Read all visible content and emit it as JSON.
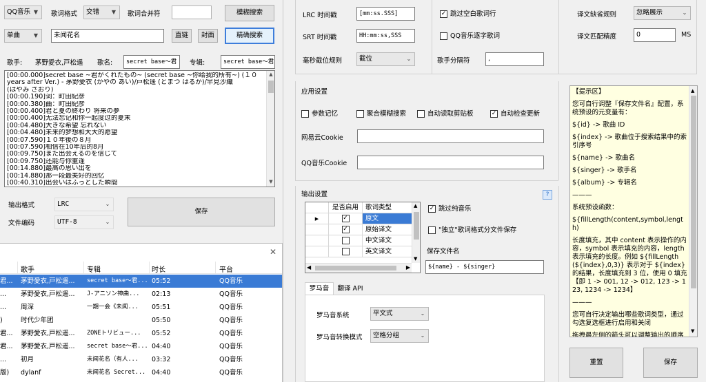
{
  "search": {
    "source_value": "QQ音乐",
    "lyric_format_label": "歌词格式",
    "lyric_format_value": "交错",
    "lyric_merge_label": "歌词合并符",
    "lyric_merge_value": "",
    "fuzzy_search_label": "模糊搜索",
    "type_value": "单曲",
    "keyword_value": "未闻花名",
    "direct_link_label": "直链",
    "cover_label": "封面",
    "exact_search_label": "精确搜索"
  },
  "song_info": {
    "singer_label": "歌手:",
    "singer_value": "茅野愛衣,戸松遥",
    "song_name_label": "歌名:",
    "song_name_value": "secret base～君",
    "album_label": "专辑:",
    "album_value": "secret base～君"
  },
  "lyrics": [
    "[00:00.000]secret base ~君がくれたもの~ (secret base ~你给我的所有~) (１０",
    "years after Ver.) - 茅野愛衣 (かやの あい)/戸松遥 (とまつ はるか)/早見沙織",
    "(はやみ さおり)",
    "[00:00.190]词：町田紀彦",
    "[00:00.380]曲：町田紀彦",
    "[00:00.400]君と夏の終わり 将来の夢",
    "[00:00.400]无法忘记和你一起度过的夏末",
    "[00:04.480]大きな希望 忘れない",
    "[00:04.480]未来的梦想和大大的愿望",
    "[00:07.590]１０年後の８月",
    "[00:07.590]相信在10年后的8月",
    "[00:09.750]また出会えるのを信じて",
    "[00:09.750]还能与你重逢",
    "[00:14.880]最高の思い出を",
    "[00:14.880]那一段最美好的回忆",
    "[00:40.310]出会いはふっとした瞬間",
    "[00:40.310]遇见你是在不经意的瞬间"
  ],
  "output": {
    "format_label": "输出格式",
    "format_value": "LRC",
    "encoding_label": "文件编码",
    "encoding_value": "UTF-8",
    "save_label": "保存"
  },
  "results": {
    "close_glyph": "✕",
    "columns": [
      "歌手",
      "专辑",
      "时长",
      "平台"
    ],
    "rows": [
      {
        "prefix": "君...",
        "singer": "茅野愛衣,戸松遥...",
        "album": "secret base～君...",
        "duration": "05:52",
        "platform": "QQ音乐",
        "selected": true
      },
      {
        "prefix": "...",
        "singer": "茅野愛衣,戸松遥...",
        "album": "J-アニソン神曲...",
        "duration": "02:13",
        "platform": "QQ音乐",
        "selected": false
      },
      {
        "prefix": "...",
        "singer": "周深",
        "album": "一期一会《未闻...",
        "duration": "05:51",
        "platform": "QQ音乐",
        "selected": false
      },
      {
        "prefix": ")",
        "singer": "时代少年团",
        "album": "",
        "duration": "05:50",
        "platform": "QQ音乐",
        "selected": false
      },
      {
        "prefix": "君...",
        "singer": "茅野愛衣,戸松遥...",
        "album": "ZONEトリビュー...",
        "duration": "05:52",
        "platform": "QQ音乐",
        "selected": false
      },
      {
        "prefix": "君...",
        "singer": "茅野愛衣,戸松遥...",
        "album": "secret base～君...",
        "duration": "04:40",
        "platform": "QQ音乐",
        "selected": false
      },
      {
        "prefix": "...",
        "singer": "初月",
        "album": "未闻花名（有人...",
        "duration": "03:32",
        "platform": "QQ音乐",
        "selected": false
      },
      {
        "prefix": "版)",
        "singer": "dylanf",
        "album": "未闻花名 Secret...",
        "duration": "04:40",
        "platform": "QQ音乐",
        "selected": false
      }
    ]
  },
  "timestamps": {
    "lrc_label": "LRC 时间戳",
    "lrc_value": "[mm:ss.SSS]",
    "srt_label": "SRT 时间戳",
    "srt_value": "HH:mm:ss,SSS",
    "ms_rule_label": "毫秒截位规则",
    "ms_rule_value": "截位",
    "skip_empty_label": "跳过空白歌词行",
    "skip_empty_checked": true,
    "qq_word_label": "QQ音乐逐字歌词",
    "qq_word_checked": false,
    "singer_sep_label": "歌手分隔符",
    "singer_sep_value": ","
  },
  "translation": {
    "missing_rule_label": "译文缺省规则",
    "missing_rule_value": "忽略展示",
    "match_precision_label": "译文匹配精度",
    "match_precision_value": "0",
    "match_precision_unit": "MS"
  },
  "app_settings": {
    "title": "应用设置",
    "param_memory_label": "参数记忆",
    "param_memory_checked": false,
    "aggregate_fuzzy_label": "聚合模糊搜索",
    "aggregate_fuzzy_checked": false,
    "auto_clipboard_label": "自动读取剪贴板",
    "auto_clipboard_checked": false,
    "auto_update_label": "自动检查更新",
    "auto_update_checked": true,
    "netease_cookie_label": "网易云Cookie",
    "qq_cookie_label": "QQ音乐Cookie"
  },
  "output_settings": {
    "title": "输出设置",
    "help_glyph": "?",
    "grid_headers": [
      "是否启用",
      "歌词类型"
    ],
    "grid_rows": [
      {
        "enabled": true,
        "type": "原文",
        "selected": true
      },
      {
        "enabled": true,
        "type": "原始译文",
        "selected": false
      },
      {
        "enabled": false,
        "type": "中文译文",
        "selected": false
      },
      {
        "enabled": false,
        "type": "英文译文",
        "selected": false
      }
    ],
    "skip_pure_music_label": "跳过纯音乐",
    "skip_pure_music_checked": true,
    "separate_file_label": "\"独立\"歌词格式分文件保存",
    "separate_file_checked": false,
    "save_filename_label": "保存文件名",
    "save_filename_value": "${name} - ${singer}"
  },
  "tabs": {
    "romaji_label": "罗马音",
    "translate_api_label": "翻译 API",
    "romaji_system_label": "罗马音系统",
    "romaji_system_value": "平文式",
    "romaji_mode_label": "罗马音转换模式",
    "romaji_mode_value": "空格分组"
  },
  "tips": [
    "【提示区】",
    "您可自行调整『保存文件名』配置，系统预设的元变量有：",
    "${id} -> 歌曲 ID",
    "${index} -> 歌曲位于搜索结果中的索引序号",
    "${name} -> 歌曲名",
    "${singer} -> 歌手名",
    "${album} -> 专辑名",
    "———",
    "系统预设函数：",
    "${fillLength(content,symbol,length)",
    "长度填充，其中 content 表示操作的内容，symbol 表示填充的内容，length 表示填充的长度。例如 ${fillLength(${index},0,3)} 表示对于 ${index} 的结果，长度填充到 3 位，使用 0 填充【即 1 -> 001, 12 -> 012, 123 -> 123, 1234 -> 1234】",
    "———",
    "您可自行决定输出哪些歌词类型，通过勾选复选框进行启用和关闭",
    "拖拽最左侧的箭头可以调整输出的顺序"
  ],
  "bottom_buttons": {
    "reset_label": "重置",
    "save_label": "保存"
  }
}
